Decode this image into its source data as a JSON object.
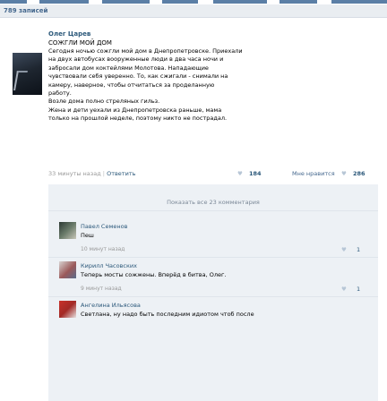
{
  "header": {
    "count_label": "789 записей"
  },
  "post": {
    "author": "Олег Царев",
    "title": "СОЖГЛИ МОЙ ДОМ",
    "body_lines": [
      "Сегодня ночью сожгли мой дом в Днепропетровске. Приехали",
      "на двух автобусах вооруженные люди в два часа ночи и",
      "забросали дом коктейлями Молотова. Нападающие",
      "чувствовали себя уверенно. То, как сжигали - снимали на",
      "камеру, наверное, чтобы отчитаться за проделанную",
      "работу.",
      "Возле дома полно стреляных гильз.",
      "Жена и дети уехали из Днепропетровска раньше, мама",
      "только на прошлой неделе, поэтому никто не пострадал."
    ],
    "meta": {
      "time": "33 минуты назад",
      "separator": "|",
      "reply": "Ответить",
      "count": "184",
      "like_label": "Мне нравится",
      "like_count": "286"
    }
  },
  "comments": {
    "show_all": "Показать все 23 комментария",
    "items": [
      {
        "name": "Павел Семенов",
        "text": "Пеш",
        "time": "10 минут назад",
        "likes": "1"
      },
      {
        "name": "Кирилл Часовских",
        "text": "Теперь мосты сожжены. Вперёд в битва, Олег.",
        "time": "9 минут назад",
        "likes": "1"
      },
      {
        "name": "Ангелина Ильясова",
        "text": "Светлана, ну надо быть последним идиотом чтоб после",
        "time": "",
        "likes": ""
      }
    ]
  },
  "colors": {
    "link": "#2b587a",
    "header_bg": "#e9edf1",
    "comments_bg": "#edf1f5"
  },
  "icons": {
    "like": "heart-icon"
  }
}
